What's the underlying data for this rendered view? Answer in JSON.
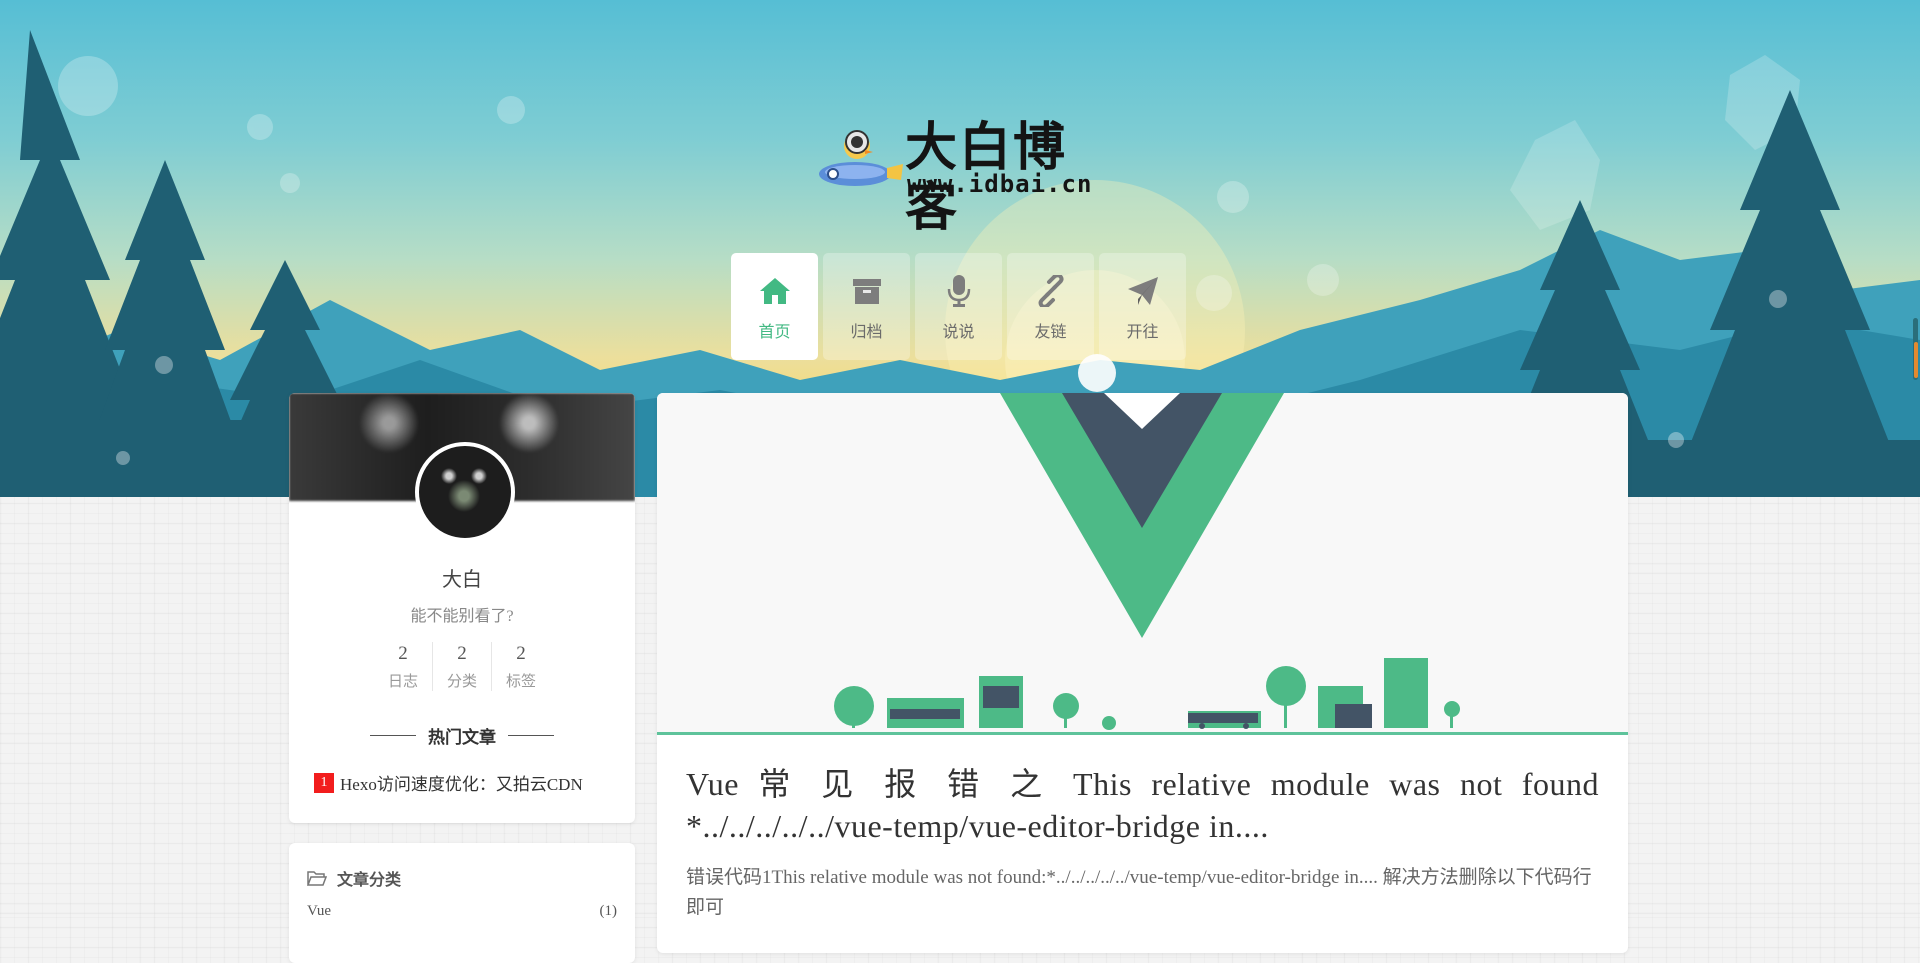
{
  "site": {
    "logo_title": "大白博客",
    "logo_url": "www.idbai.cn",
    "colors": {
      "accent": "#42b983",
      "hot_rank": "#f21d1d"
    }
  },
  "nav": [
    {
      "label": "首页",
      "icon": "home-icon",
      "active": true
    },
    {
      "label": "归档",
      "icon": "archive-icon",
      "active": false
    },
    {
      "label": "说说",
      "icon": "microphone-icon",
      "active": false
    },
    {
      "label": "友链",
      "icon": "link-icon",
      "active": false
    },
    {
      "label": "开往",
      "icon": "paper-plane-icon",
      "active": false
    }
  ],
  "profile": {
    "name": "大白",
    "description": "能不能别看了?",
    "stats": [
      {
        "num": "2",
        "label": "日志"
      },
      {
        "num": "2",
        "label": "分类"
      },
      {
        "num": "2",
        "label": "标签"
      }
    ],
    "hot_title": "热门文章",
    "hot_posts": [
      {
        "rank": "1",
        "title": "Hexo访问速度优化：又拍云CDN"
      }
    ]
  },
  "categories": {
    "title": "文章分类",
    "items": [
      {
        "name": "Vue",
        "count": "(1)"
      }
    ]
  },
  "post": {
    "cover_icon": "vue-logo-icon",
    "title": "Vue 常 见 报 错 之 This relative module was not found *../../../../../vue-temp/vue-editor-bridge in....",
    "excerpt": "错误代码1This relative module was not found:*../../../../../vue-temp/vue-editor-bridge in.... 解决方法删除以下代码行即可"
  }
}
